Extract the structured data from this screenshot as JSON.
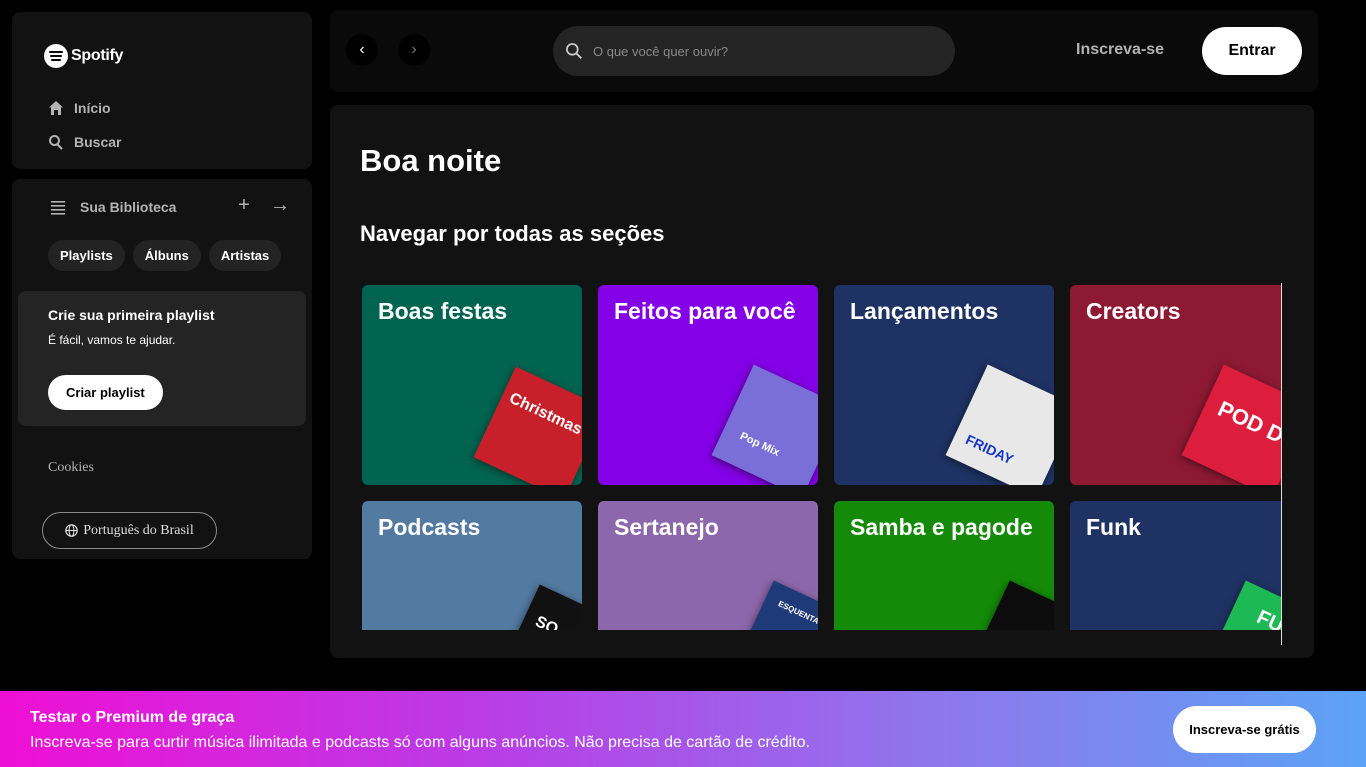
{
  "brand": {
    "name": "Spotify"
  },
  "nav": {
    "home": "Início",
    "search": "Buscar"
  },
  "library": {
    "title": "Sua Biblioteca",
    "chips": [
      "Playlists",
      "Álbuns",
      "Artistas"
    ],
    "promo": {
      "title": "Crie sua primeira playlist",
      "subtitle": "É fácil, vamos te ajudar.",
      "button": "Criar playlist"
    },
    "cookies": "Cookies",
    "language": "Português do Brasil"
  },
  "topbar": {
    "search_placeholder": "O que você quer ouvir?",
    "signup": "Inscreva-se",
    "login": "Entrar"
  },
  "main": {
    "greeting": "Boa noite",
    "section_title": "Navegar por todas as seções",
    "cards": [
      {
        "title": "Boas festas",
        "color": "#006450",
        "cover_color": "#c7202a",
        "cover_text": "Christmas Hits"
      },
      {
        "title": "Feitos para você",
        "color": "#8400e7",
        "cover_color": "#7a6fd8",
        "cover_text": "Pop Mix"
      },
      {
        "title": "Lançamentos",
        "color": "#1e3264",
        "cover_color": "#e8e8e8",
        "cover_text": "FRIDAY"
      },
      {
        "title": "Creators",
        "color": "#8d1932",
        "cover_color": "#dc1d3c",
        "cover_text": "POD DELAS"
      },
      {
        "title": "Podcasts",
        "color": "#537aa1",
        "cover_color": "#111111",
        "cover_text": "SO"
      },
      {
        "title": "Sertanejo",
        "color": "#8d67ab",
        "cover_color": "#1e3a78",
        "cover_text": "ESQUENTA SERTANEJO"
      },
      {
        "title": "Samba e pagode",
        "color": "#148a08",
        "cover_color": "#0c0c0c",
        "cover_text": ""
      },
      {
        "title": "Funk",
        "color": "#1e3264",
        "cover_color": "#1db954",
        "cover_text": "FUNK"
      }
    ]
  },
  "banner": {
    "title": "Testar o Premium de graça",
    "subtitle": "Inscreva-se para curtir música ilimitada e podcasts só com alguns anúncios. Não precisa de cartão de crédito.",
    "button": "Inscreva-se grátis"
  },
  "colors": {
    "background": "#000000",
    "panel": "#121212",
    "accent_gradient_start": "#ee0fd4",
    "accent_gradient_end": "#5ba3f4"
  }
}
